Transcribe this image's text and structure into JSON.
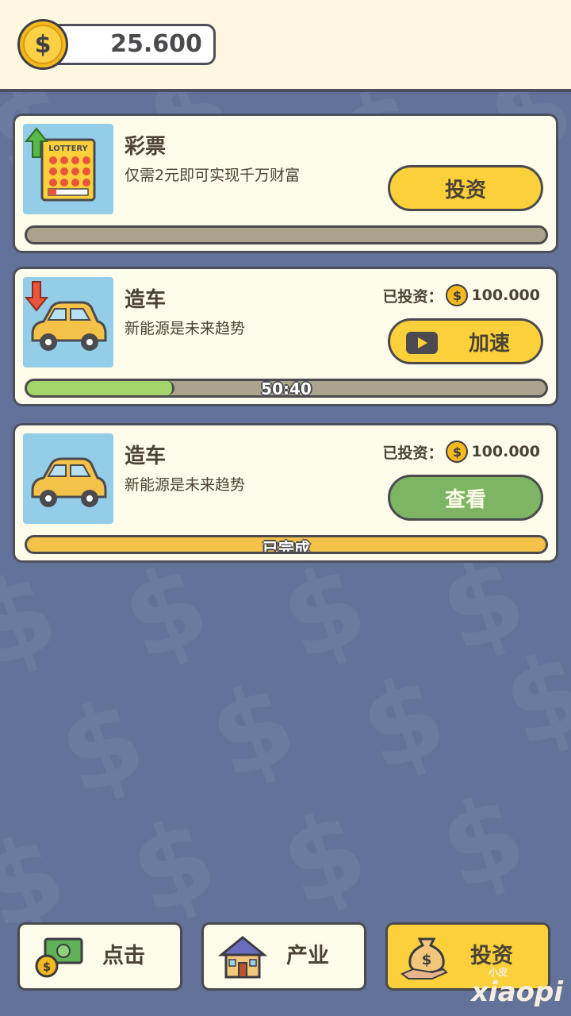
{
  "header": {
    "coin_balance": "25.600",
    "coin_icon": "dollar-coin-icon"
  },
  "cards": [
    {
      "title": "彩票",
      "description": "仅需2元即可实现千万财富",
      "icon": "lottery-ticket-icon",
      "trend": "up-arrow-icon",
      "button_label": "投资",
      "progress": 0,
      "progress_text": ""
    },
    {
      "title": "造车",
      "description": "新能源是未来趋势",
      "icon": "car-icon",
      "trend": "down-arrow-icon",
      "invested_label": "已投资：",
      "invested_value": "100.000",
      "button_label": "加速",
      "button_icon": "video-play-icon",
      "progress": 0.28,
      "progress_text": "50:40"
    },
    {
      "title": "造车",
      "description": "新能源是未来趋势",
      "icon": "car-icon",
      "invested_label": "已投资：",
      "invested_value": "100.000",
      "button_label": "查看",
      "progress": 1,
      "progress_text": "已完成"
    }
  ],
  "bottom_nav": [
    {
      "label": "点击",
      "icon": "cash-coins-icon",
      "active": false
    },
    {
      "label": "产业",
      "icon": "house-icon",
      "active": false
    },
    {
      "label": "投资",
      "icon": "money-bag-hand-icon",
      "active": true
    }
  ],
  "watermark": {
    "text": "xiaopi",
    "sub": "小皮"
  },
  "colors": {
    "background": "#627299",
    "card": "#fdfbe9",
    "yellow_button": "#fbd03b",
    "green_button": "#7db562",
    "progress_green": "#a3d46a",
    "progress_yellow": "#f4c249",
    "progress_track": "#aaa48c"
  }
}
